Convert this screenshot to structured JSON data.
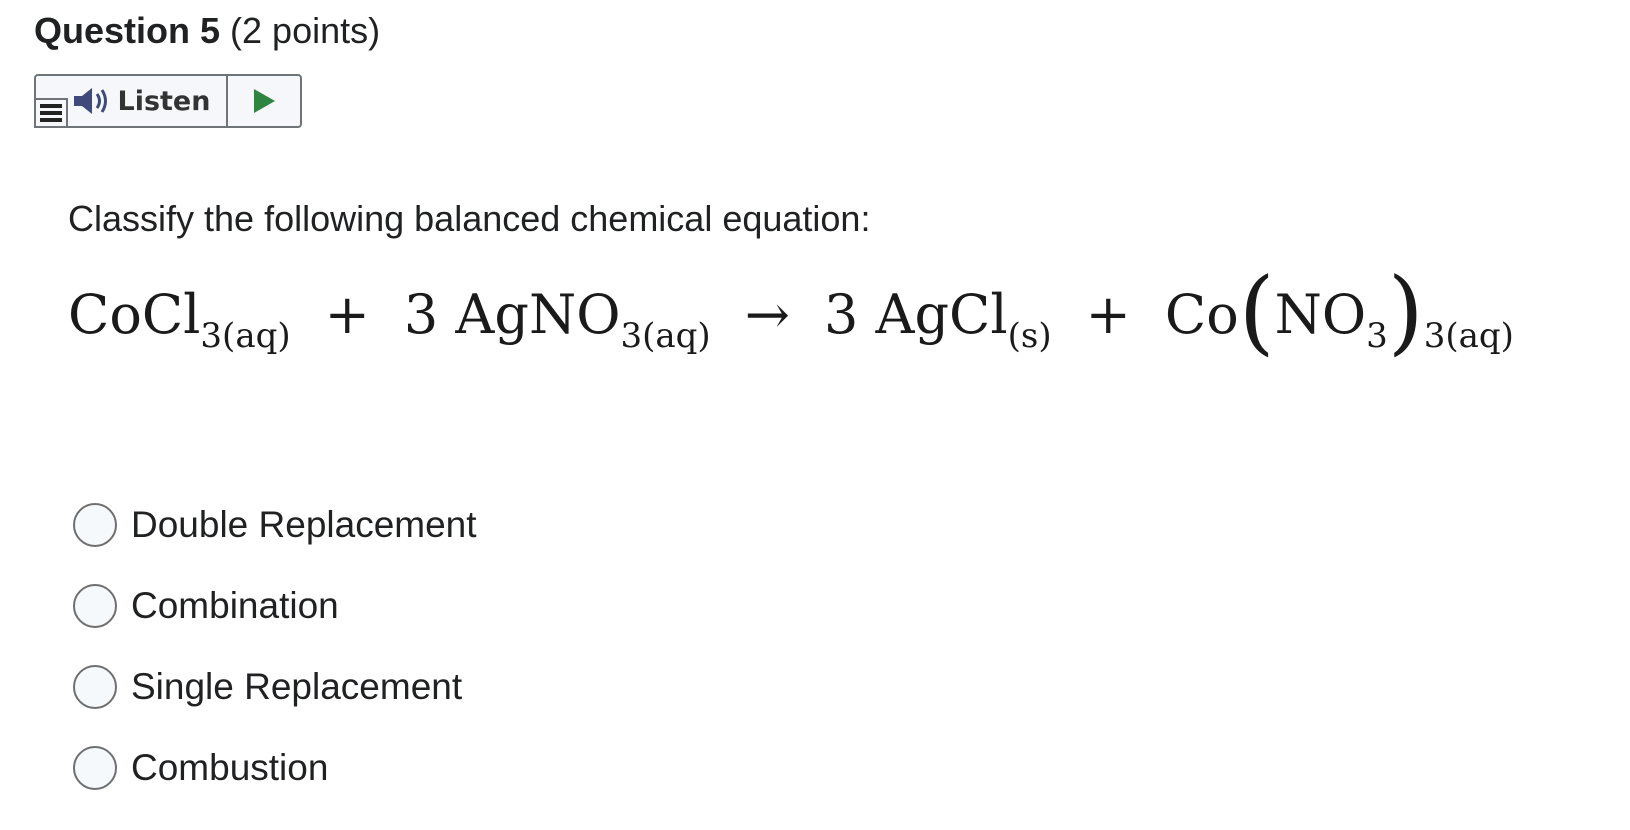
{
  "question": {
    "title": "Question 5",
    "points": "(2 points)"
  },
  "listen_toolbar": {
    "label": "Listen",
    "menu_icon": "menu-icon",
    "speaker_icon": "speaker-icon",
    "play_icon": "play-icon",
    "play_color": "#2e8540"
  },
  "prompt": "Classify the following balanced chemical equation:",
  "equation": {
    "reactant1": "CoCl",
    "reactant1_sub": "3(aq)",
    "plus1": "+",
    "reactant2_coef": "3",
    "reactant2": "AgNO",
    "reactant2_sub": "3(aq)",
    "arrow": "→",
    "product1_coef": "3",
    "product1": "AgCl",
    "product1_sub": "(s)",
    "plus2": "+",
    "product2_prefix": "Co",
    "paren_open": "(",
    "product2_inner": "NO",
    "product2_inner_sub": "3",
    "paren_close": ")",
    "product2_sub": "3(aq)"
  },
  "options": [
    {
      "label": "Double Replacement",
      "selected": false
    },
    {
      "label": "Combination",
      "selected": false
    },
    {
      "label": "Single Replacement",
      "selected": false
    },
    {
      "label": "Combustion",
      "selected": false
    }
  ]
}
